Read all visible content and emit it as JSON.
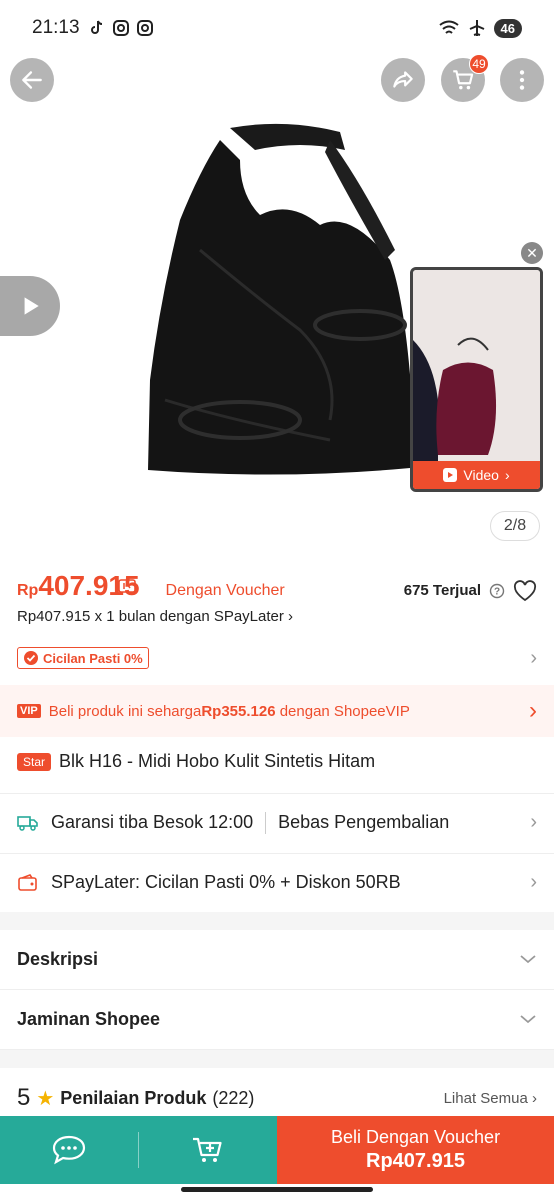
{
  "status_bar": {
    "time": "21:13",
    "battery": "46"
  },
  "header": {
    "cart_count": "49"
  },
  "gallery": {
    "page_indicator": "2/8",
    "video_label": "Video"
  },
  "product": {
    "price_currency": "Rp",
    "price_value": "407.915",
    "voucher_text": "Dengan Voucher",
    "sold_count": "675 Terjual",
    "spaylater_line": "Rp407.915 x 1 bulan dengan SPayLater",
    "cicilan_badge": "Cicilan Pasti 0%",
    "vip_tag": "VIP",
    "vip_prefix": "Beli produk ini seharga ",
    "vip_price": "Rp355.126",
    "vip_suffix": " dengan ShopeeVIP",
    "star_tag": "Star",
    "title": "Blk H16 - Midi Hobo Kulit Sintetis Hitam"
  },
  "info_rows": {
    "shipping": "Garansi tiba Besok 12:00",
    "returns": "Bebas Pengembalian",
    "spaylater": "SPayLater: Cicilan Pasti 0% + Diskon 50RB"
  },
  "sections": {
    "description": "Deskripsi",
    "guarantee": "Jaminan Shopee"
  },
  "ratings": {
    "score": "5",
    "title": "Penilaian Produk",
    "count": "(222)",
    "see_all": "Lihat Semua"
  },
  "bottom_bar": {
    "buy_label": "Beli Dengan Voucher",
    "buy_price": "Rp407.915"
  },
  "colors": {
    "brand": "#ee4d2d",
    "teal": "#26aa99"
  }
}
